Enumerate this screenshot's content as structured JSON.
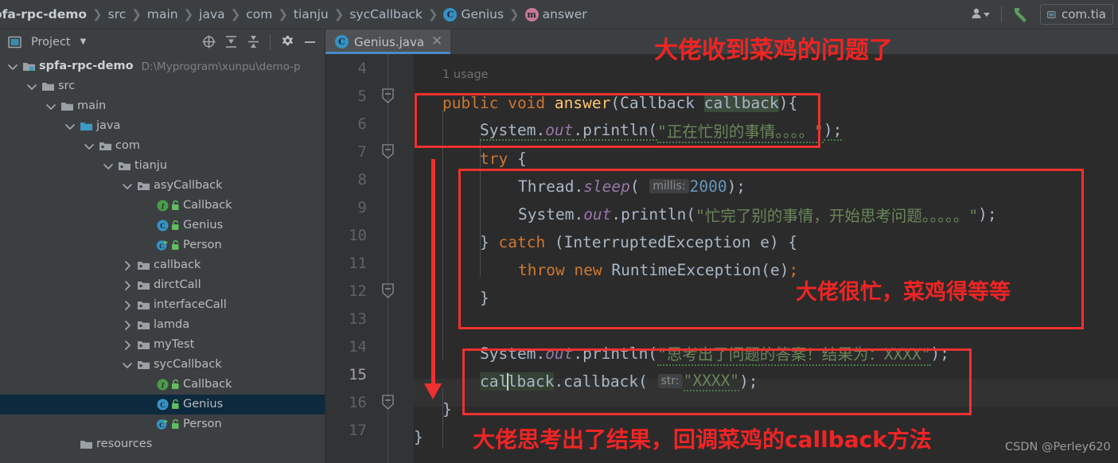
{
  "window": {
    "theme_bg": "#2b2b2b",
    "panel_bg": "#3c3f41",
    "accent": "#4a88c7",
    "annotation_color": "#f02424"
  },
  "breadcrumb": {
    "items": [
      {
        "label": "ofa-rpc-demo",
        "icon": "",
        "root": true
      },
      {
        "label": "src",
        "icon": ""
      },
      {
        "label": "main",
        "icon": ""
      },
      {
        "label": "java",
        "icon": ""
      },
      {
        "label": "com",
        "icon": ""
      },
      {
        "label": "tianju",
        "icon": ""
      },
      {
        "label": "sycCallback",
        "icon": ""
      },
      {
        "label": "Genius",
        "icon": "class-badge-icon"
      },
      {
        "label": "answer",
        "icon": "method-badge-icon"
      }
    ],
    "separator": "❯",
    "right": {
      "user_icon": "user-dropdown-icon",
      "build_icon": "build-hammer-icon",
      "run_config_label": "com.tia"
    }
  },
  "sidebar": {
    "toolbar": {
      "title": "Project",
      "dropdown_caret": "▼",
      "locate_icon": "locate-target-icon",
      "expand_icon": "expand-all-icon",
      "collapse_icon": "collapse-all-icon",
      "settings_icon": "gear-icon",
      "minimize_icon": "minimize-icon"
    },
    "tree": [
      {
        "label": "spfa-rpc-demo",
        "path": "D:\\Myprogram\\xunpu\\demo-p",
        "icon": "module-folder-icon",
        "twist": "expanded",
        "indent": 0,
        "bold": true,
        "selected": false
      },
      {
        "label": "src",
        "icon": "folder-icon",
        "twist": "expanded",
        "indent": 1,
        "selected": false
      },
      {
        "label": "main",
        "icon": "folder-icon",
        "twist": "expanded",
        "indent": 2,
        "selected": false
      },
      {
        "label": "java",
        "icon": "source-folder-icon",
        "twist": "expanded",
        "indent": 3,
        "selected": false
      },
      {
        "label": "com",
        "icon": "package-icon",
        "twist": "expanded",
        "indent": 4,
        "selected": false
      },
      {
        "label": "tianju",
        "icon": "package-icon",
        "twist": "expanded",
        "indent": 5,
        "selected": false
      },
      {
        "label": "asyCallback",
        "icon": "package-icon",
        "twist": "expanded",
        "indent": 6,
        "selected": false
      },
      {
        "label": "Callback",
        "icon": "interface-icon",
        "twist": "none",
        "indent": 7,
        "lock": true,
        "selected": false
      },
      {
        "label": "Genius",
        "icon": "class-icon",
        "twist": "none",
        "indent": 7,
        "lock": true,
        "selected": false
      },
      {
        "label": "Person",
        "icon": "runnable-class-icon",
        "twist": "none",
        "indent": 7,
        "lock": true,
        "selected": false
      },
      {
        "label": "callback",
        "icon": "package-icon",
        "twist": "collapsed",
        "indent": 6,
        "selected": false
      },
      {
        "label": "dirctCall",
        "icon": "package-icon",
        "twist": "collapsed",
        "indent": 6,
        "selected": false
      },
      {
        "label": "interfaceCall",
        "icon": "package-icon",
        "twist": "collapsed",
        "indent": 6,
        "selected": false
      },
      {
        "label": "lamda",
        "icon": "package-icon",
        "twist": "collapsed",
        "indent": 6,
        "selected": false
      },
      {
        "label": "myTest",
        "icon": "package-icon",
        "twist": "collapsed",
        "indent": 6,
        "selected": false
      },
      {
        "label": "sycCallback",
        "icon": "package-icon",
        "twist": "expanded",
        "indent": 6,
        "selected": false
      },
      {
        "label": "Callback",
        "icon": "interface-icon",
        "twist": "none",
        "indent": 7,
        "lock": true,
        "selected": false
      },
      {
        "label": "Genius",
        "icon": "class-icon",
        "twist": "none",
        "indent": 7,
        "lock": true,
        "selected": true
      },
      {
        "label": "Person",
        "icon": "runnable-class-icon",
        "twist": "none",
        "indent": 7,
        "lock": true,
        "selected": false
      },
      {
        "label": "resources",
        "icon": "folder-icon",
        "twist": "none",
        "indent": 3,
        "selected": false
      }
    ]
  },
  "editor": {
    "tab": {
      "label": "Genius.java",
      "icon": "class-badge-icon",
      "close": "✕"
    },
    "gutter": {
      "line_numbers": [
        "4",
        "5",
        "6",
        "7",
        "8",
        "9",
        "10",
        "11",
        "12",
        "13",
        "14",
        "15",
        "16",
        "17"
      ],
      "current_line": "15",
      "fold_lines": [
        "5",
        "7",
        "12",
        "16"
      ]
    },
    "code": {
      "usage_hint": "1 usage",
      "l5": {
        "kw1": "public",
        "kw2": "void",
        "name": "answer",
        "type": "Callback",
        "param": "callback",
        "tail": "){"
      },
      "l6": {
        "obj": "System.",
        "fld": "out",
        "m": ".println(",
        "str": "\"正在忙别的事情。。。。\"",
        "end": ");"
      },
      "l7": {
        "kw": "try",
        "tail": " {"
      },
      "l8": {
        "obj": "Thread.",
        "m": "sleep",
        "open": "( ",
        "hint": "millis:",
        "num": "2000",
        "end": ");"
      },
      "l9": {
        "obj": "System.",
        "fld": "out",
        "m": ".println(",
        "str": "\"忙完了别的事情，开始思考问题。。。。。\"",
        "end": ");"
      },
      "l10": {
        "close": "} ",
        "kw": "catch",
        "rest": " (InterruptedException e) {"
      },
      "l11": {
        "kw1": "throw",
        "kw2": "new",
        "rest": " RuntimeException(e)",
        "semi": ";"
      },
      "l12": {
        "text": "}"
      },
      "l14": {
        "obj": "System.",
        "fld": "out",
        "m": ".println(",
        "str": "\"思考出了问题的答案！结果为：XXXX\"",
        "end": ");"
      },
      "l15": {
        "recv": "callback",
        "m": ".callback(",
        "open": " ",
        "hint": "str:",
        "str": "\"XXXX\"",
        "end": ");"
      },
      "l16": {
        "text": "}"
      },
      "l17": {
        "text": "}"
      }
    }
  },
  "annotations": {
    "top": "大佬收到菜鸡的问题了",
    "middle": "大佬很忙，菜鸡得等等",
    "bottom": "大佬思考出了结果，回调菜鸡的callback方法",
    "watermark": "CSDN @Perley620"
  }
}
